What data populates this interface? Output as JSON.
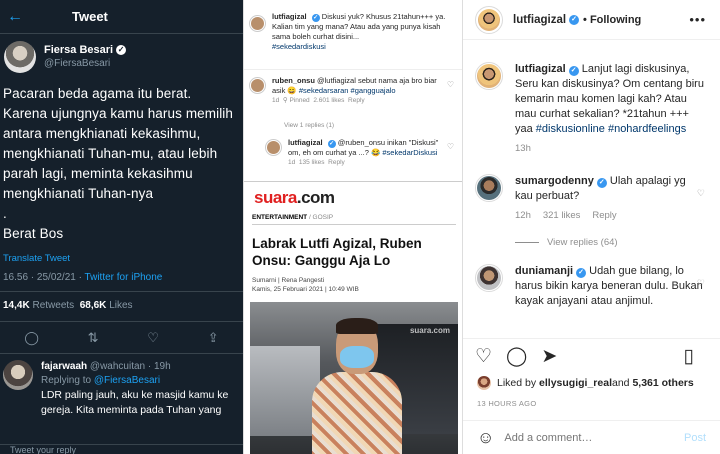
{
  "twitter": {
    "back_icon": "arrow-left-icon",
    "title": "Tweet",
    "author": {
      "name": "Fiersa Besari",
      "handle": "@FiersaBesari"
    },
    "body": "Pacaran beda agama itu berat.\nKarena ujungnya kamu harus memilih antara mengkhianati kekasihmu, mengkhianati Tuhan-mu, atau lebih parah lagi, meminta kekasihmu mengkhianati Tuhan-nya\n.\nBerat Bos",
    "translate": "Translate Tweet",
    "time": "16.56 · 25/02/21 · ",
    "source": "Twitter for iPhone",
    "retweets": "14,4K",
    "retweets_label": "Retweets",
    "likes": "68,6K",
    "likes_label": "Likes",
    "reply": {
      "name": "fajarwaah",
      "handle": "@wahcuitan · 19h",
      "replying_prefix": "Replying to ",
      "replying_to": "@FiersaBesari",
      "text": "LDR paling jauh, aku ke masjid kamu ke gereja. Kita meminta pada Tuhan yang"
    },
    "compose_placeholder": "Tweet your reply"
  },
  "collage": {
    "comment1": {
      "user": "lutfiagizal",
      "text": "Diskusi yuk? Khusus 21tahun+++ ya. Kalian tim yang mana? Atau ada yang punya kisah sama boleh curhat disini...",
      "tag": "#sekedardiskusi"
    },
    "comment2": {
      "user": "ruben_onsu",
      "text": "@lutfiagizal sebut nama aja bro biar asik 😄",
      "tag": "#sekedarsaran #gangguajalo",
      "time": "1d",
      "pinned": "Pinned",
      "likes": "2.601 likes",
      "reply": "Reply"
    },
    "view_replies": "View 1 replies (1)",
    "comment3": {
      "user": "lutfiagizal",
      "text": "@ruben_onsu inikan \"Diskusi\" om, eh om curhat ya ...? 😂",
      "tag": "#sekedarDiskusi",
      "time": "1d",
      "likes": "135 likes",
      "reply": "Reply"
    },
    "news": {
      "logo": "suara",
      "logo_suffix": ".com",
      "category": "ENTERTAINMENT",
      "subcategory": " / GOSIP",
      "headline": "Labrak Lutfi Agizal, Ruben Onsu: Ganggu Aja Lo",
      "byline": "Sumarni | Rena Pangesti",
      "date": "Kamis, 25 Februari 2021 | 10:49 WIB",
      "watermark": "suara.com"
    }
  },
  "instagram": {
    "header": {
      "user": "lutfiagizal",
      "follow": "• Following",
      "more_icon": "more-dots-icon"
    },
    "comments": [
      {
        "user": "lutfiagizal",
        "text": " Lanjut lagi diskusinya, Seru kan diskusinya? Om centang biru kemarin mau komen lagi kah? Atau mau curhat sekalian? *21tahun +++ yaa ",
        "tags": "#diskusionline #nohardfeelings",
        "time": "13h",
        "likes": "",
        "reply": ""
      },
      {
        "user": "sumargodenny",
        "text": " Ulah apalagi yg kau perbuat?",
        "tags": "",
        "time": "12h",
        "likes": "321 likes",
        "reply": "Reply"
      },
      {
        "user": "duniamanji",
        "text": " Udah gue bilang, lo harus bikin karya beneran dulu. Bukan kayak anjayani atau anjimul.",
        "tags": "",
        "time": "",
        "likes": "",
        "reply": ""
      }
    ],
    "view_replies": "View replies (64)",
    "liked_prefix": "Liked by ",
    "liked_user": "ellysugigi_real",
    "liked_and": " and ",
    "liked_count": "5,361 others",
    "timestamp": "13 HOURS AGO",
    "add_comment_placeholder": "Add a comment…",
    "post_label": "Post",
    "icons": [
      "heart-icon",
      "comment-icon",
      "share-icon",
      "bookmark-icon",
      "emoji-icon"
    ]
  }
}
